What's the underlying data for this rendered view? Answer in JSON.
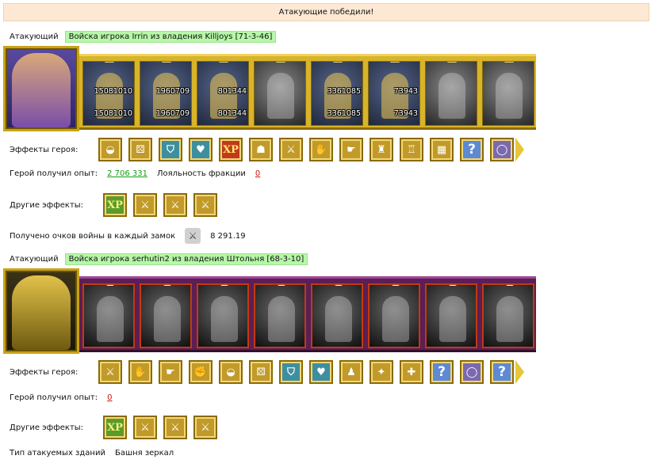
{
  "banner": "Атакующие победили!",
  "armies": [
    {
      "side_label": "Атакующий",
      "title": "Войска игрока Irrin из владения Killjoys [71-3-46]",
      "units": [
        {
          "top": "15081010",
          "bottom": "15081010",
          "style": "color"
        },
        {
          "top": "1960709",
          "bottom": "1960709",
          "style": "color"
        },
        {
          "top": "801344",
          "bottom": "801344",
          "style": "color"
        },
        {
          "top": "",
          "bottom": "",
          "style": "gray"
        },
        {
          "top": "3361085",
          "bottom": "3361085",
          "style": "color"
        },
        {
          "top": "73943",
          "bottom": "73943",
          "style": "color"
        },
        {
          "top": "",
          "bottom": "",
          "style": "gray"
        },
        {
          "top": "",
          "bottom": "",
          "style": "gray"
        }
      ],
      "hero_effects_label": "Эффекты героя:",
      "hero_effects": [
        "hat-icon",
        "dice-icon",
        "shield-icon",
        "shield-heart-icon",
        "XP",
        "unit-xp-icon",
        "sword-icon",
        "handshake-icon",
        "hand-icon",
        "tower-icon",
        "castle-icon",
        "fort-icon",
        "?",
        "ring-icon"
      ],
      "xp_label": "Герой получил опыт:",
      "xp_value": "2 706 331",
      "loyalty_label": "Лояльность фракции",
      "loyalty_value": "0",
      "other_effects_label": "Другие эффекты:",
      "other_effects": [
        "XP",
        "sword-attack-icon",
        "sword-attack-icon",
        "sword-attack-icon"
      ],
      "war_points_label": "Получено очков войны в каждый замок",
      "war_points_value": "8 291.19"
    },
    {
      "side_label": "Атакующий",
      "title": "Войска игрока serhutin2 из владения Штольня [68-3-10]",
      "units": [
        {
          "top": "",
          "bottom": ""
        },
        {
          "top": "",
          "bottom": ""
        },
        {
          "top": "",
          "bottom": ""
        },
        {
          "top": "",
          "bottom": ""
        },
        {
          "top": "",
          "bottom": ""
        },
        {
          "top": "",
          "bottom": ""
        },
        {
          "top": "",
          "bottom": ""
        },
        {
          "top": "",
          "bottom": ""
        }
      ],
      "hero_effects_label": "Эффекты героя:",
      "hero_effects": [
        "sword-icon",
        "handshake-icon",
        "hand-icon",
        "fist-icon",
        "hat-icon",
        "dice-icon",
        "shield-icon",
        "shield-heart-icon",
        "armor-icon",
        "star-icon",
        "cross-icon",
        "?",
        "ring-icon",
        "?"
      ],
      "xp_label": "Герой получил опыт:",
      "xp_value": "0",
      "other_effects_label": "Другие эффекты:",
      "other_effects": [
        "XP",
        "sword-attack-icon",
        "sword-attack-icon",
        "sword-attack-icon"
      ],
      "building_type_label": "Тип атакуемых зданий",
      "building_type_value": "Башня зеркал"
    }
  ],
  "colors": {
    "banner_bg": "#fde8d4",
    "tag_green": "#b6f7a8",
    "link_green": "#12a012",
    "link_red": "#d21010"
  }
}
